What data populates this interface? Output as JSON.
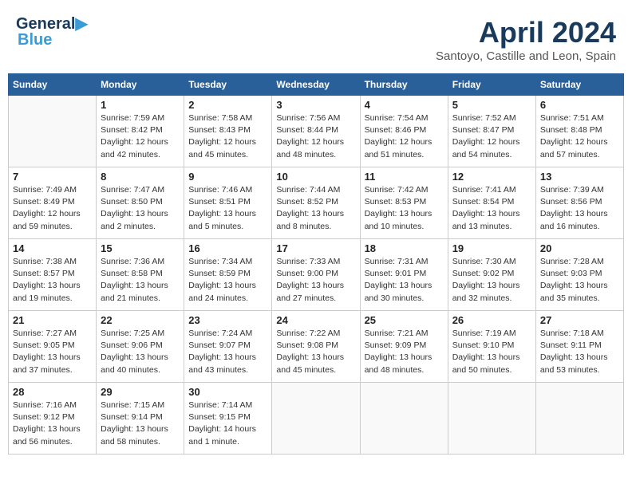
{
  "logo": {
    "line1": "General",
    "line2": "Blue"
  },
  "title": "April 2024",
  "location": "Santoyo, Castille and Leon, Spain",
  "days_of_week": [
    "Sunday",
    "Monday",
    "Tuesday",
    "Wednesday",
    "Thursday",
    "Friday",
    "Saturday"
  ],
  "weeks": [
    [
      {
        "day": "",
        "info": ""
      },
      {
        "day": "1",
        "info": "Sunrise: 7:59 AM\nSunset: 8:42 PM\nDaylight: 12 hours\nand 42 minutes."
      },
      {
        "day": "2",
        "info": "Sunrise: 7:58 AM\nSunset: 8:43 PM\nDaylight: 12 hours\nand 45 minutes."
      },
      {
        "day": "3",
        "info": "Sunrise: 7:56 AM\nSunset: 8:44 PM\nDaylight: 12 hours\nand 48 minutes."
      },
      {
        "day": "4",
        "info": "Sunrise: 7:54 AM\nSunset: 8:46 PM\nDaylight: 12 hours\nand 51 minutes."
      },
      {
        "day": "5",
        "info": "Sunrise: 7:52 AM\nSunset: 8:47 PM\nDaylight: 12 hours\nand 54 minutes."
      },
      {
        "day": "6",
        "info": "Sunrise: 7:51 AM\nSunset: 8:48 PM\nDaylight: 12 hours\nand 57 minutes."
      }
    ],
    [
      {
        "day": "7",
        "info": "Sunrise: 7:49 AM\nSunset: 8:49 PM\nDaylight: 12 hours\nand 59 minutes."
      },
      {
        "day": "8",
        "info": "Sunrise: 7:47 AM\nSunset: 8:50 PM\nDaylight: 13 hours\nand 2 minutes."
      },
      {
        "day": "9",
        "info": "Sunrise: 7:46 AM\nSunset: 8:51 PM\nDaylight: 13 hours\nand 5 minutes."
      },
      {
        "day": "10",
        "info": "Sunrise: 7:44 AM\nSunset: 8:52 PM\nDaylight: 13 hours\nand 8 minutes."
      },
      {
        "day": "11",
        "info": "Sunrise: 7:42 AM\nSunset: 8:53 PM\nDaylight: 13 hours\nand 10 minutes."
      },
      {
        "day": "12",
        "info": "Sunrise: 7:41 AM\nSunset: 8:54 PM\nDaylight: 13 hours\nand 13 minutes."
      },
      {
        "day": "13",
        "info": "Sunrise: 7:39 AM\nSunset: 8:56 PM\nDaylight: 13 hours\nand 16 minutes."
      }
    ],
    [
      {
        "day": "14",
        "info": "Sunrise: 7:38 AM\nSunset: 8:57 PM\nDaylight: 13 hours\nand 19 minutes."
      },
      {
        "day": "15",
        "info": "Sunrise: 7:36 AM\nSunset: 8:58 PM\nDaylight: 13 hours\nand 21 minutes."
      },
      {
        "day": "16",
        "info": "Sunrise: 7:34 AM\nSunset: 8:59 PM\nDaylight: 13 hours\nand 24 minutes."
      },
      {
        "day": "17",
        "info": "Sunrise: 7:33 AM\nSunset: 9:00 PM\nDaylight: 13 hours\nand 27 minutes."
      },
      {
        "day": "18",
        "info": "Sunrise: 7:31 AM\nSunset: 9:01 PM\nDaylight: 13 hours\nand 30 minutes."
      },
      {
        "day": "19",
        "info": "Sunrise: 7:30 AM\nSunset: 9:02 PM\nDaylight: 13 hours\nand 32 minutes."
      },
      {
        "day": "20",
        "info": "Sunrise: 7:28 AM\nSunset: 9:03 PM\nDaylight: 13 hours\nand 35 minutes."
      }
    ],
    [
      {
        "day": "21",
        "info": "Sunrise: 7:27 AM\nSunset: 9:05 PM\nDaylight: 13 hours\nand 37 minutes."
      },
      {
        "day": "22",
        "info": "Sunrise: 7:25 AM\nSunset: 9:06 PM\nDaylight: 13 hours\nand 40 minutes."
      },
      {
        "day": "23",
        "info": "Sunrise: 7:24 AM\nSunset: 9:07 PM\nDaylight: 13 hours\nand 43 minutes."
      },
      {
        "day": "24",
        "info": "Sunrise: 7:22 AM\nSunset: 9:08 PM\nDaylight: 13 hours\nand 45 minutes."
      },
      {
        "day": "25",
        "info": "Sunrise: 7:21 AM\nSunset: 9:09 PM\nDaylight: 13 hours\nand 48 minutes."
      },
      {
        "day": "26",
        "info": "Sunrise: 7:19 AM\nSunset: 9:10 PM\nDaylight: 13 hours\nand 50 minutes."
      },
      {
        "day": "27",
        "info": "Sunrise: 7:18 AM\nSunset: 9:11 PM\nDaylight: 13 hours\nand 53 minutes."
      }
    ],
    [
      {
        "day": "28",
        "info": "Sunrise: 7:16 AM\nSunset: 9:12 PM\nDaylight: 13 hours\nand 56 minutes."
      },
      {
        "day": "29",
        "info": "Sunrise: 7:15 AM\nSunset: 9:14 PM\nDaylight: 13 hours\nand 58 minutes."
      },
      {
        "day": "30",
        "info": "Sunrise: 7:14 AM\nSunset: 9:15 PM\nDaylight: 14 hours\nand 1 minute."
      },
      {
        "day": "",
        "info": ""
      },
      {
        "day": "",
        "info": ""
      },
      {
        "day": "",
        "info": ""
      },
      {
        "day": "",
        "info": ""
      }
    ]
  ]
}
